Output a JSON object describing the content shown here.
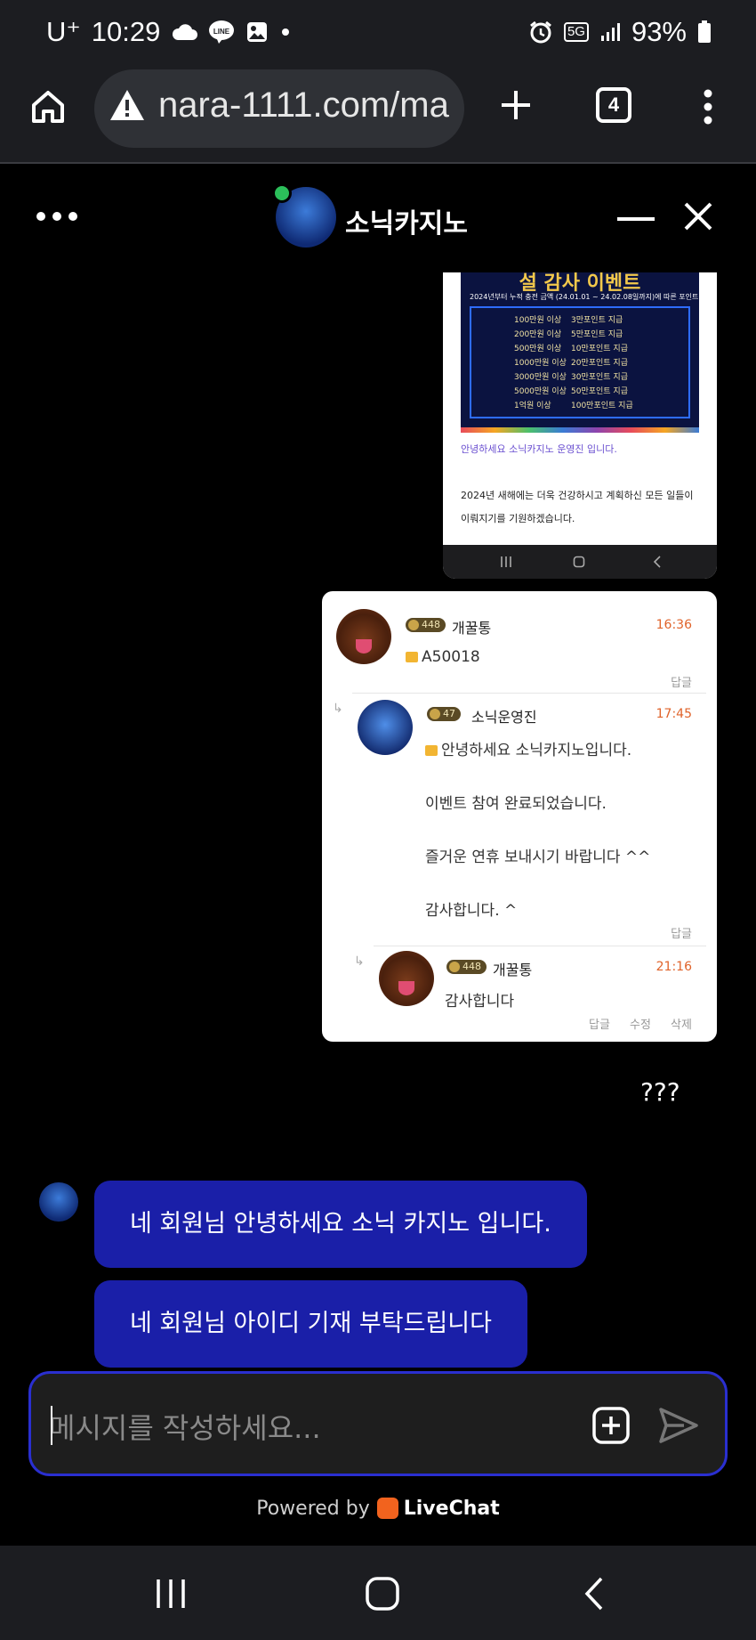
{
  "status_bar": {
    "carrier": "U⁺",
    "time": "10:29",
    "network": "5G",
    "battery": "93%"
  },
  "browser": {
    "url": "nara-1111.com/ma",
    "tab_count": "4"
  },
  "chat_header": {
    "title": "소닉카지노"
  },
  "image1": {
    "event_title": "설 감사 이벤트",
    "event_subtitle": "2024년부터 누적 충전 금액 (24.01.01 ~ 24.02.08일까지)에 따른 포인트 지급",
    "event_rows": [
      {
        "amount": "100만원 이상",
        "reward": "3만포인트 지급"
      },
      {
        "amount": "200만원 이상",
        "reward": "5만포인트 지급"
      },
      {
        "amount": "500만원 이상",
        "reward": "10만포인트 지급"
      },
      {
        "amount": "1000만원 이상",
        "reward": "20만포인트 지급"
      },
      {
        "amount": "3000만원 이상",
        "reward": "30만포인트 지급"
      },
      {
        "amount": "5000만원 이상",
        "reward": "50만포인트 지급"
      },
      {
        "amount": "1억원 이상",
        "reward": "100만포인트 지급"
      }
    ],
    "greeting": "안녕하세요 소닉카지노 운영진 입니다.",
    "body": "2024년 새해에는 더욱 건강하시고 계획하신 모든 일들이 이뤄지기를 기원하겠습니다."
  },
  "image2": {
    "comments": [
      {
        "level": "448",
        "nick": "개꿀통",
        "time": "16:36",
        "text": "A50018",
        "reply": "답글"
      },
      {
        "level": "47",
        "nick": "소닉운영진",
        "time": "17:45",
        "lines": [
          "안녕하세요 소닉카지노입니다.",
          "이벤트 참여 완료되었습니다.",
          "즐거운 연휴 보내시기 바랍니다 ^^",
          "감사합니다. ^"
        ],
        "reply": "답글"
      },
      {
        "level": "448",
        "nick": "개꿀통",
        "time": "21:16",
        "text": "감사합니다",
        "reply": "답글",
        "edit": "수정",
        "delete": "삭제"
      }
    ]
  },
  "user_message": "???",
  "agent_messages": [
    "네 회원님 안녕하세요 소닉 카지노 입니다.",
    "네 회원님 아이디 기재 부탁드립니다"
  ],
  "composer": {
    "placeholder": "메시지를 작성하세요..."
  },
  "footer": {
    "powered_by": "Powered by",
    "brand": "LiveChat"
  },
  "colors": {
    "agent_bubble": "#1a1fa8",
    "composer_border": "#2a2fd0",
    "online": "#2bbf5a",
    "livechat_orange": "#f2631e"
  }
}
